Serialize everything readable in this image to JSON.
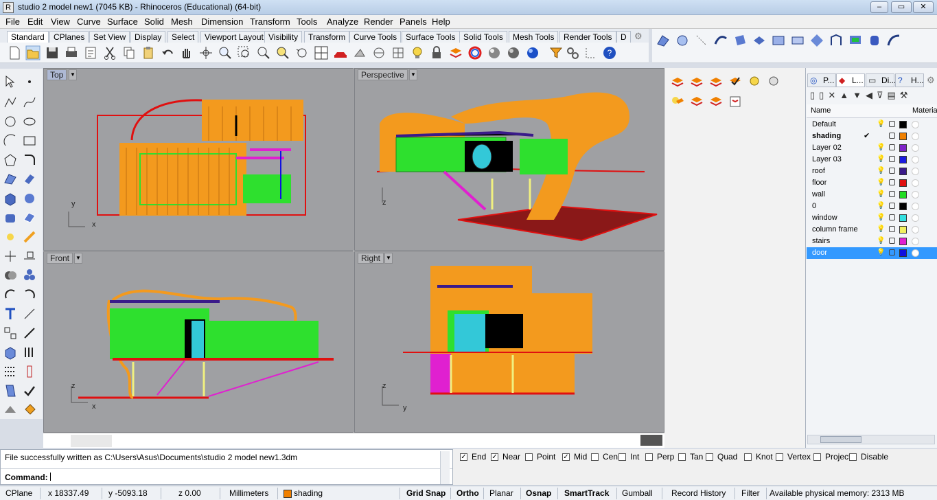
{
  "window": {
    "title": "studio 2 model new1 (7045 KB) - Rhinoceros (Educational) (64-bit)"
  },
  "menu": [
    "File",
    "Edit",
    "View",
    "Curve",
    "Surface",
    "Solid",
    "Mesh",
    "Dimension",
    "Transform",
    "Tools",
    "Analyze",
    "Render",
    "Panels",
    "Help"
  ],
  "toolbar_tabs": [
    "Standard",
    "CPlanes",
    "Set View",
    "Display",
    "Select",
    "Viewport Layout",
    "Visibility",
    "Transform",
    "Curve Tools",
    "Surface Tools",
    "Solid Tools",
    "Mesh Tools",
    "Render Tools",
    "D"
  ],
  "viewports": [
    {
      "name": "Top",
      "axis1": "y",
      "axis2": "x"
    },
    {
      "name": "Perspective",
      "axis1": "z",
      "axis2": ""
    },
    {
      "name": "Front",
      "axis1": "z",
      "axis2": "x"
    },
    {
      "name": "Right",
      "axis1": "z",
      "axis2": "y"
    }
  ],
  "panel_tabs": [
    "P...",
    "L...",
    "Di...",
    "H..."
  ],
  "layers": {
    "header_name": "Name",
    "header_material": "Material",
    "rows": [
      {
        "name": "Default",
        "color": "#000000",
        "current": false,
        "selected": false
      },
      {
        "name": "shading",
        "color": "#f08000",
        "current": true,
        "selected": false
      },
      {
        "name": "Layer 02",
        "color": "#7f22c8",
        "current": false,
        "selected": false
      },
      {
        "name": "Layer 03",
        "color": "#1a1ae0",
        "current": false,
        "selected": false
      },
      {
        "name": "roof",
        "color": "#3a1a8a",
        "current": false,
        "selected": false
      },
      {
        "name": "floor",
        "color": "#e01010",
        "current": false,
        "selected": false
      },
      {
        "name": "wall",
        "color": "#22dd22",
        "current": false,
        "selected": false
      },
      {
        "name": "0",
        "color": "#000000",
        "current": false,
        "selected": false
      },
      {
        "name": "window",
        "color": "#33e0e0",
        "current": false,
        "selected": false
      },
      {
        "name": "column frame",
        "color": "#f0f060",
        "current": false,
        "selected": false
      },
      {
        "name": "stairs",
        "color": "#e020d0",
        "current": false,
        "selected": false
      },
      {
        "name": "door",
        "color": "#1010e0",
        "current": false,
        "selected": true
      }
    ]
  },
  "command": {
    "history": "File successfully written as C:\\Users\\Asus\\Documents\\studio 2 model new1.3dm",
    "prompt": "Command:"
  },
  "osnaps": [
    {
      "label": "End",
      "checked": true
    },
    {
      "label": "Near",
      "checked": true
    },
    {
      "label": "Point",
      "checked": false
    },
    {
      "label": "Mid",
      "checked": true
    },
    {
      "label": "Cen",
      "checked": false
    },
    {
      "label": "Int",
      "checked": false
    },
    {
      "label": "Perp",
      "checked": false
    },
    {
      "label": "Tan",
      "checked": false
    },
    {
      "label": "Quad",
      "checked": false
    },
    {
      "label": "Knot",
      "checked": false
    },
    {
      "label": "Vertex",
      "checked": false
    },
    {
      "label": "Project",
      "checked": false
    },
    {
      "label": "Disable",
      "checked": false
    }
  ],
  "status": {
    "cplane": "CPlane",
    "x": "x 18337.49",
    "y": "y -5093.18",
    "z": "z 0.00",
    "units": "Millimeters",
    "layer": "shading",
    "layer_color": "#f08000",
    "grid_snap": "Grid Snap",
    "ortho": "Ortho",
    "planar": "Planar",
    "osnap": "Osnap",
    "smarttrack": "SmartTrack",
    "gumball": "Gumball",
    "record_history": "Record History",
    "filter": "Filter",
    "memory": "Available physical memory: 2313 MB"
  },
  "colors": {
    "orange": "#f39a1e",
    "green": "#2ee02e",
    "red": "#e01010",
    "purple": "#3a1a8a",
    "cyan": "#33c8d8",
    "magenta": "#e020d0",
    "yellow": "#f0f080"
  }
}
